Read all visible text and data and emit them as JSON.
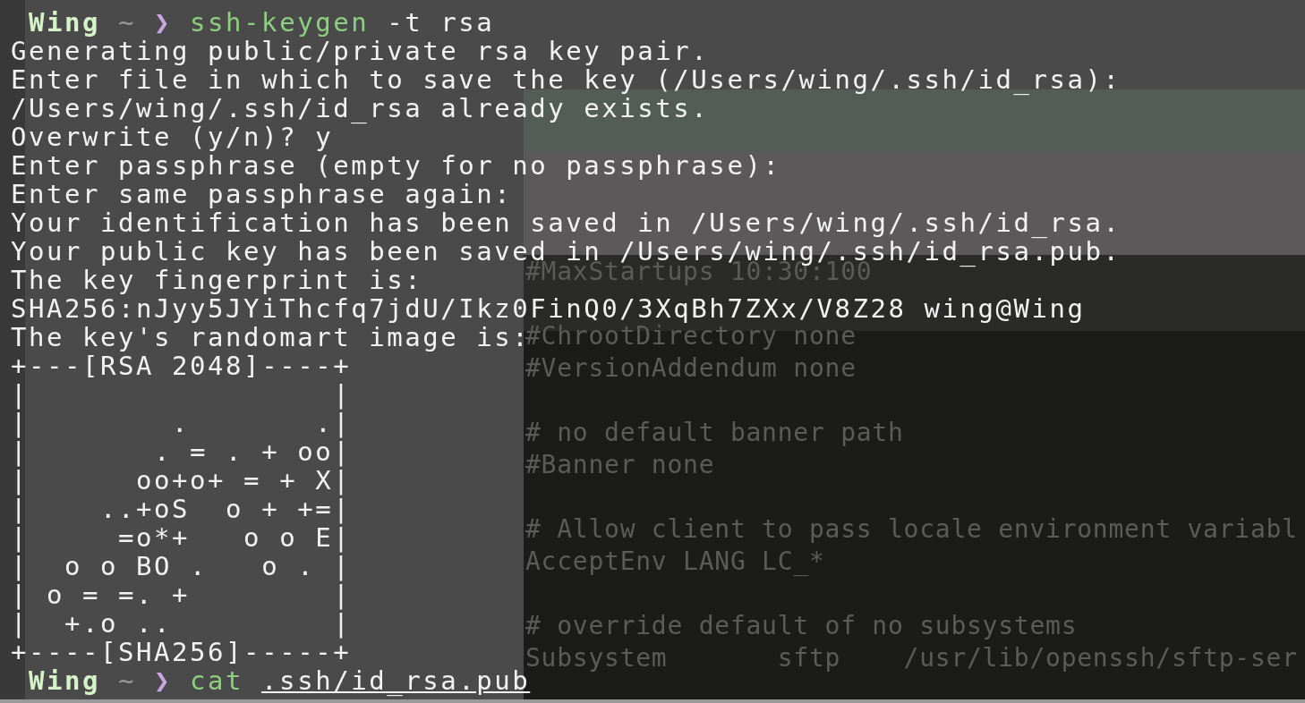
{
  "background_editor": {
    "blocks": [
      [
        "#MaxStartups 10:30:100"
      ],
      [
        "#ChrootDirectory none",
        "#VersionAddendum none"
      ],
      [
        "# no default banner path",
        "#Banner none"
      ],
      [
        "# Allow client to pass locale environment variabl",
        "AcceptEnv LANG LC_*"
      ],
      [
        "# override default of no subsystems",
        "Subsystem       sftp    /usr/lib/openssh/sftp-ser"
      ]
    ]
  },
  "terminal": {
    "lines": [
      {
        "kind": "prompt",
        "user": "Wing",
        "directory": "~",
        "symbol": "❯",
        "command": "ssh-keygen",
        "arguments": "-t rsa",
        "underlined": false
      },
      {
        "kind": "output",
        "text": "Generating public/private rsa key pair."
      },
      {
        "kind": "output",
        "text": "Enter file in which to save the key (/Users/wing/.ssh/id_rsa):"
      },
      {
        "kind": "output",
        "text": "/Users/wing/.ssh/id_rsa already exists."
      },
      {
        "kind": "output",
        "text": "Overwrite (y/n)? y"
      },
      {
        "kind": "output",
        "text": "Enter passphrase (empty for no passphrase):"
      },
      {
        "kind": "output",
        "text": "Enter same passphrase again:"
      },
      {
        "kind": "output",
        "text": "Your identification has been saved in /Users/wing/.ssh/id_rsa."
      },
      {
        "kind": "output",
        "text": "Your public key has been saved in /Users/wing/.ssh/id_rsa.pub."
      },
      {
        "kind": "output",
        "text": "The key fingerprint is:"
      },
      {
        "kind": "output",
        "text": "SHA256:nJyy5JYiThcfq7jdU/Ikz0FinQ0/3XqBh7ZXx/V8Z28 wing@Wing"
      },
      {
        "kind": "output",
        "text": "The key's randomart image is:"
      },
      {
        "kind": "output",
        "text": "+---[RSA 2048]----+"
      },
      {
        "kind": "output",
        "text": "|                 |"
      },
      {
        "kind": "output",
        "text": "|        .       .|"
      },
      {
        "kind": "output",
        "text": "|       . = . + oo|"
      },
      {
        "kind": "output",
        "text": "|      oo+o+ = + X|"
      },
      {
        "kind": "output",
        "text": "|    ..+oS  o + +=|"
      },
      {
        "kind": "output",
        "text": "|     =o*+   o o E|"
      },
      {
        "kind": "output",
        "text": "|  o o BO .   o . |"
      },
      {
        "kind": "output",
        "text": "| o = =. +        |"
      },
      {
        "kind": "output",
        "text": "|  +.o ..         |"
      },
      {
        "kind": "output",
        "text": "+----[SHA256]-----+"
      },
      {
        "kind": "prompt",
        "user": "Wing",
        "directory": "~",
        "symbol": "❯",
        "command": "cat",
        "arguments": ".ssh/id_rsa.pub",
        "underlined": true
      }
    ]
  }
}
